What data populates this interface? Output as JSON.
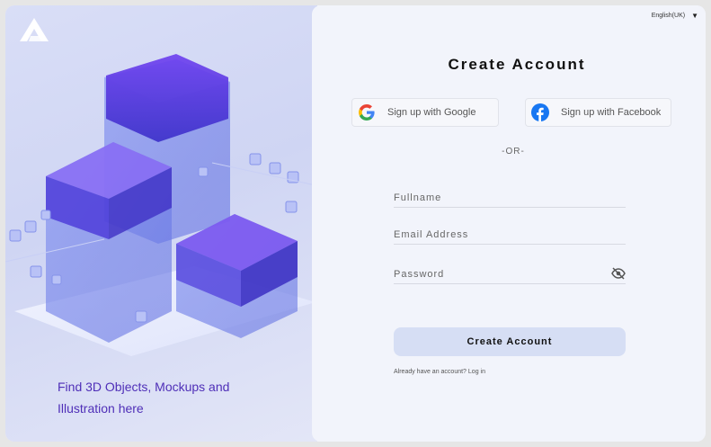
{
  "brand": {
    "logo_icon": "brand-logo-icon"
  },
  "hero": {
    "tagline": "Find 3D Objects, Mockups and Illustration here"
  },
  "language": {
    "label": "English(UK)",
    "icon": "caret-down-icon"
  },
  "form": {
    "title": "Create Account",
    "google_label": "Sign up with Google",
    "facebook_label": "Sign up with Facebook",
    "divider": "-OR-",
    "fullname_placeholder": "Fullname",
    "email_placeholder": "Email Address",
    "password_placeholder": "Password",
    "submit_label": "Create Account",
    "login_prefix": "Already have an account?",
    "login_link": "Log in"
  },
  "colors": {
    "accent": "#4f2fb8",
    "button_bg": "#d6def4",
    "panel_bg": "#f2f4fb",
    "facebook": "#1877f2"
  }
}
